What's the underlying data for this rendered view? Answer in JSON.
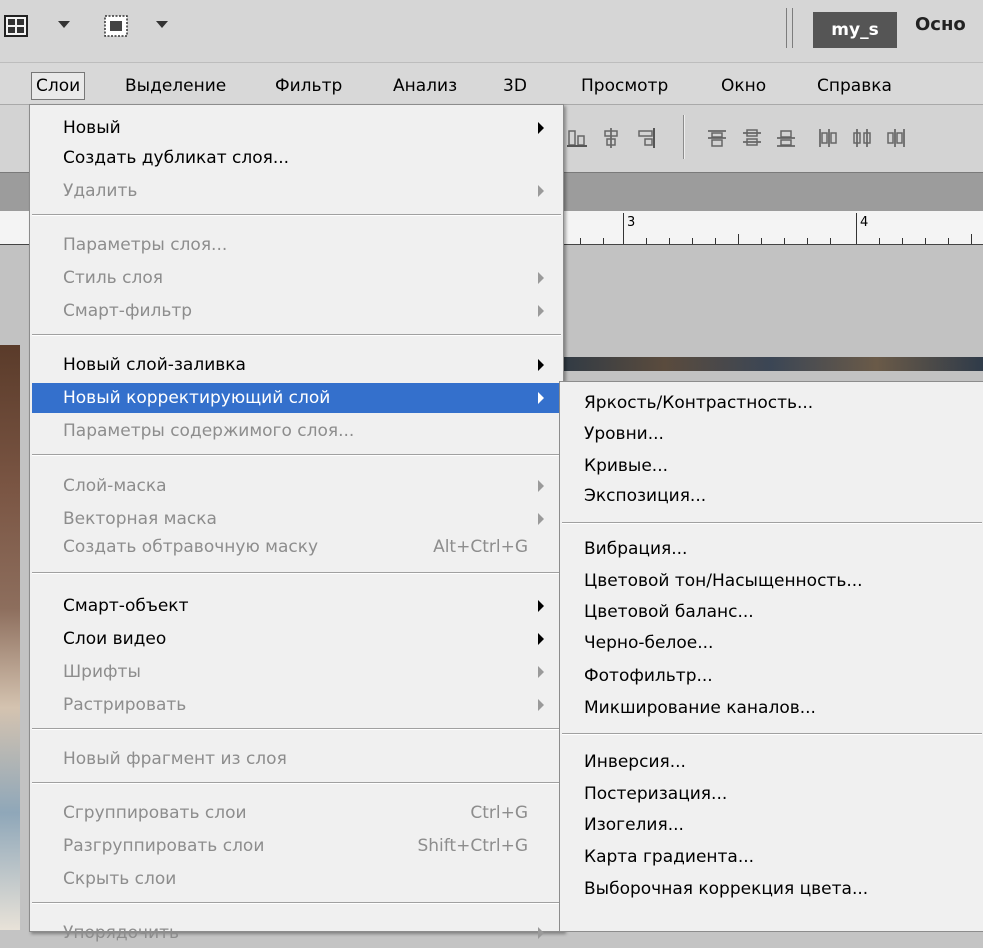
{
  "workspace": {
    "active": "my_s",
    "next": "Осно"
  },
  "menubar": [
    "Слои",
    "Выделение",
    "Фильтр",
    "Анализ",
    "3D",
    "Просмотр",
    "Окно",
    "Справка"
  ],
  "ruler": {
    "labels": [
      "3",
      "4"
    ]
  },
  "layer_menu": {
    "groups": [
      [
        {
          "label": "Новый",
          "submenu": true,
          "enabled": true
        },
        {
          "label": "Создать дубликат слоя...",
          "submenu": false,
          "enabled": true
        },
        {
          "label": "Удалить",
          "submenu": true,
          "enabled": false
        }
      ],
      [
        {
          "label": "Параметры слоя...",
          "submenu": false,
          "enabled": false
        },
        {
          "label": "Стиль слоя",
          "submenu": true,
          "enabled": false
        },
        {
          "label": "Смарт-фильтр",
          "submenu": true,
          "enabled": false
        }
      ],
      [
        {
          "label": "Новый слой-заливка",
          "submenu": true,
          "enabled": true
        },
        {
          "label": "Новый корректирующий слой",
          "submenu": true,
          "enabled": true,
          "highlighted": true
        },
        {
          "label": "Параметры содержимого слоя...",
          "submenu": false,
          "enabled": false
        }
      ],
      [
        {
          "label": "Слой-маска",
          "submenu": true,
          "enabled": false
        },
        {
          "label": "Векторная маска",
          "submenu": true,
          "enabled": false
        },
        {
          "label": "Создать обтравочную маску",
          "shortcut": "Alt+Ctrl+G",
          "submenu": false,
          "enabled": false
        }
      ],
      [
        {
          "label": "Смарт-объект",
          "submenu": true,
          "enabled": true
        },
        {
          "label": "Слои видео",
          "submenu": true,
          "enabled": true
        },
        {
          "label": "Шрифты",
          "submenu": true,
          "enabled": false
        },
        {
          "label": "Растрировать",
          "submenu": true,
          "enabled": false
        }
      ],
      [
        {
          "label": "Новый фрагмент из слоя",
          "submenu": false,
          "enabled": false
        }
      ],
      [
        {
          "label": "Сгруппировать слои",
          "shortcut": "Ctrl+G",
          "submenu": false,
          "enabled": false
        },
        {
          "label": "Разгруппировать слои",
          "shortcut": "Shift+Ctrl+G",
          "submenu": false,
          "enabled": false
        },
        {
          "label": "Скрыть слои",
          "submenu": false,
          "enabled": false
        }
      ],
      [
        {
          "label": "Упорядочить",
          "submenu": true,
          "enabled": false
        }
      ]
    ]
  },
  "adjustment_submenu": {
    "groups": [
      [
        "Яркость/Контрастность...",
        "Уровни...",
        "Кривые...",
        "Экспозиция..."
      ],
      [
        "Вибрация...",
        "Цветовой тон/Насыщенность...",
        "Цветовой баланс...",
        "Черно-белое...",
        "Фотофильтр...",
        "Микширование каналов..."
      ],
      [
        "Инверсия...",
        "Постеризация...",
        "Изогелия...",
        "Карта градиента...",
        "Выборочная коррекция цвета..."
      ]
    ]
  },
  "colors": {
    "highlight": "#3470cc",
    "disabled_text": "#8d8d8d",
    "menu_bg": "#f0f0f0"
  }
}
